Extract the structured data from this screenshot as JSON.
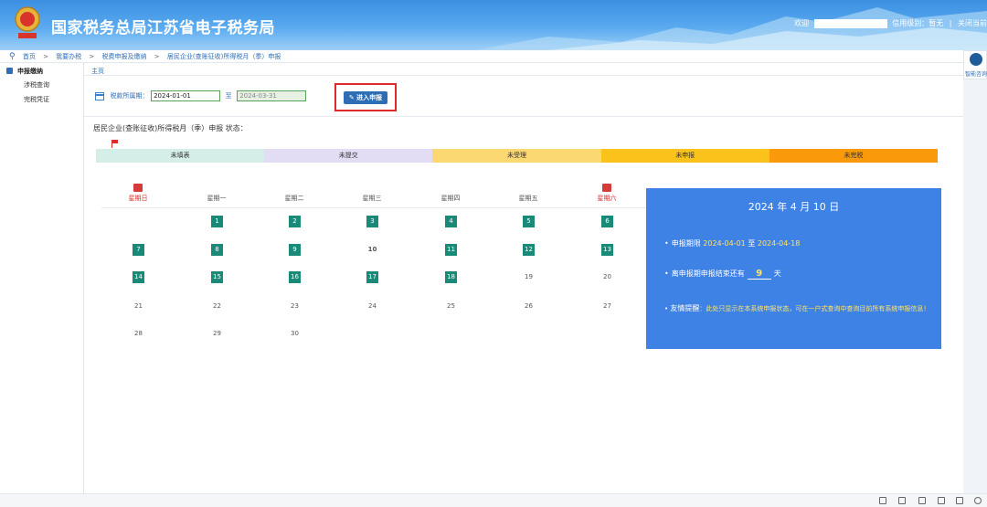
{
  "header": {
    "site_title": "国家税务总局江苏省电子税务局",
    "welcome_label": "欢迎",
    "credit_label": "信用级别：暂无",
    "close_label": "关闭当前"
  },
  "breadcrumb": {
    "items": [
      "首页",
      "我要办税",
      "税费申报及缴纳",
      "居民企业(查账征收)所得税月（季）申报"
    ]
  },
  "sidebar": {
    "items": [
      {
        "label": "申报缴纳",
        "active": true
      },
      {
        "label": "涉税查询",
        "active": false
      },
      {
        "label": "完税凭证",
        "active": false
      }
    ]
  },
  "assistant": {
    "label": "智能咨询"
  },
  "tabs": {
    "home": "主页"
  },
  "period": {
    "label": "税款所属期：",
    "start": "2024-01-01",
    "to": "至",
    "end": "2024-03-31"
  },
  "enter_button": {
    "label": "进入申报"
  },
  "status": {
    "title": "居民企业(查账征收)所得税月（季）申报 状态：",
    "segments": [
      {
        "label": "未填表",
        "color": "#d6eee8"
      },
      {
        "label": "未提交",
        "color": "#e3dcf5"
      },
      {
        "label": "未受理",
        "color": "#fcd873"
      },
      {
        "label": "未申报",
        "color": "#fbc21b"
      },
      {
        "label": "未完税",
        "color": "#fa9a0a"
      }
    ]
  },
  "calendar": {
    "weekdays": [
      "星期日",
      "星期一",
      "星期二",
      "星期三",
      "星期四",
      "星期五",
      "星期六"
    ],
    "weeks": [
      [
        null,
        "1",
        "2",
        "3",
        "4",
        "5",
        "6"
      ],
      [
        "7",
        "8",
        "9",
        "10",
        "11",
        "12",
        "13"
      ],
      [
        "14",
        "15",
        "16",
        "17",
        "18",
        "19",
        "20"
      ],
      [
        "21",
        "22",
        "23",
        "24",
        "25",
        "26",
        "27"
      ],
      [
        "28",
        "29",
        "30",
        null,
        null,
        null,
        null
      ]
    ],
    "highlight_days": [
      "1",
      "2",
      "3",
      "4",
      "5",
      "6",
      "7",
      "8",
      "9",
      "11",
      "12",
      "13",
      "14",
      "15",
      "16",
      "17",
      "18"
    ],
    "today": "10"
  },
  "info": {
    "date": "2024 年 4 月 10 日",
    "period_label": "申报期限",
    "period_start": "2024-04-01",
    "period_to": "至",
    "period_end": "2024-04-18",
    "remaining_label": "离申报期申报结束还有",
    "remaining_days": "9",
    "remaining_unit": "天",
    "notice_label": "友情提醒",
    "notice_text": "：此处只显示在本系统申报状态，可在一户式查询中查询目前所有系统申报信息！"
  }
}
